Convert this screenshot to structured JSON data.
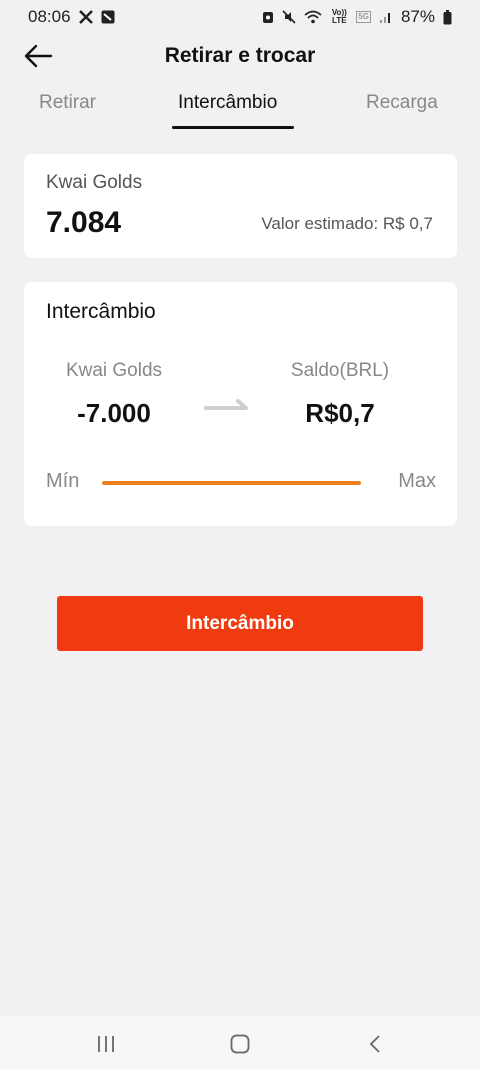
{
  "status_bar": {
    "time": "08:06",
    "battery": "87%",
    "volte": "Vo)) LTE",
    "network": "5G"
  },
  "header": {
    "title": "Retirar e trocar"
  },
  "tabs": [
    {
      "label": "Retirar",
      "active": false
    },
    {
      "label": "Intercâmbio",
      "active": true
    },
    {
      "label": "Recarga",
      "active": false
    }
  ],
  "balance_card": {
    "label": "Kwai Golds",
    "value": "7.084",
    "estimate": "Valor estimado: R$ 0,7"
  },
  "exchange_card": {
    "title": "Intercâmbio",
    "from_label": "Kwai Golds",
    "from_value": "-7.000",
    "to_label": "Saldo(BRL)",
    "to_value": "R$0,7",
    "slider_min": "Mín",
    "slider_max": "Max",
    "slider_level": 1.0
  },
  "action": {
    "button_label": "Intercâmbio"
  },
  "colors": {
    "accent_button": "#ef3b0f",
    "slider": "#ee7f1c",
    "background": "#f1f1f3"
  }
}
